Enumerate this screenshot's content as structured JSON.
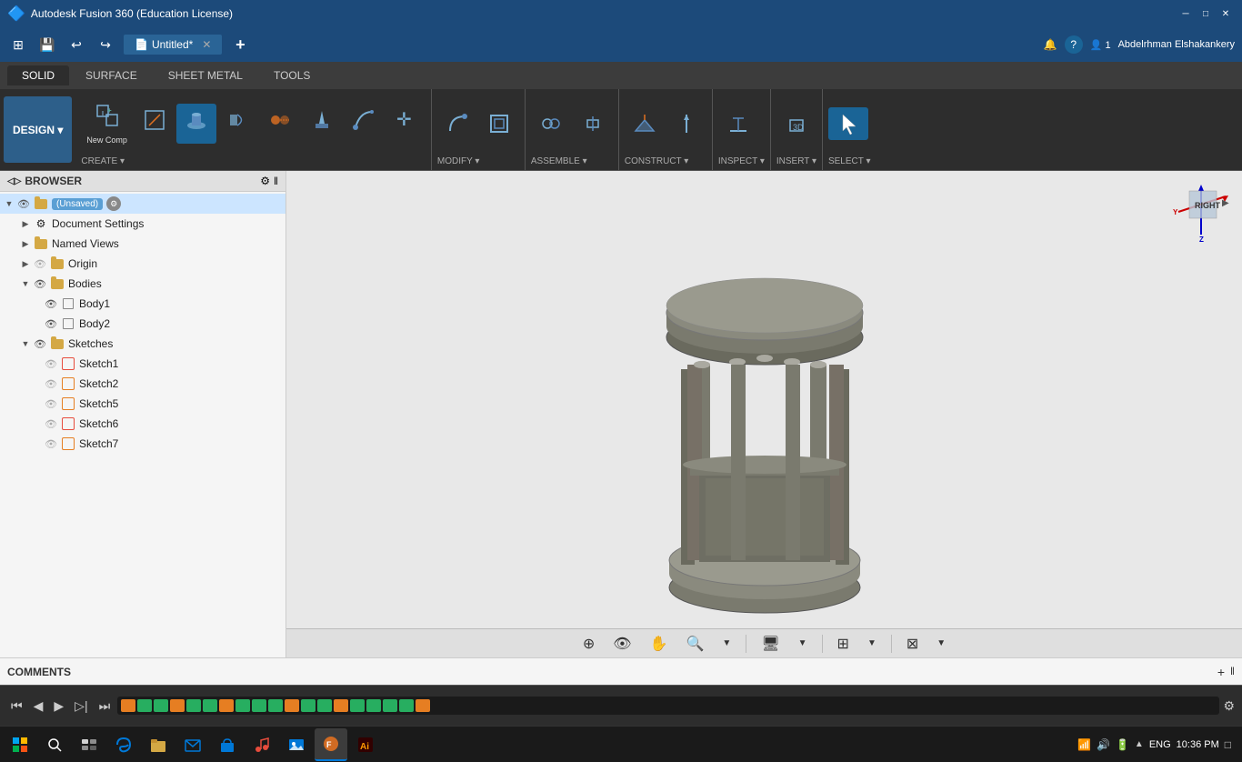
{
  "app": {
    "title": "Autodesk Fusion 360 (Education License)",
    "icon": "🔷"
  },
  "window_controls": {
    "minimize": "─",
    "maximize": "□",
    "close": "✕"
  },
  "header": {
    "file_tab": "Untitled*",
    "file_tab_close": "✕",
    "user": "Abdelrhman Elshakankery",
    "user_icon": "👤",
    "count": "1",
    "help": "?",
    "plus": "+",
    "refresh": "↺"
  },
  "ribbon": {
    "design_label": "DESIGN ▾",
    "tabs": [
      "SOLID",
      "SURFACE",
      "SHEET METAL",
      "TOOLS"
    ],
    "active_tab": "SOLID",
    "sections": {
      "create": {
        "label": "CREATE ▾",
        "buttons": [
          {
            "icon": "⊞",
            "label": "New Comp"
          },
          {
            "icon": "◻",
            "label": ""
          },
          {
            "icon": "◑",
            "label": ""
          },
          {
            "icon": "▣",
            "label": ""
          },
          {
            "icon": "✦",
            "label": ""
          },
          {
            "icon": "◧",
            "label": ""
          },
          {
            "icon": "⬡",
            "label": ""
          },
          {
            "icon": "⬢",
            "label": ""
          },
          {
            "icon": "✛",
            "label": ""
          }
        ]
      },
      "modify": {
        "label": "MODIFY ▾"
      },
      "assemble": {
        "label": "ASSEMBLE ▾"
      },
      "construct": {
        "label": "CONSTRUCT ▾"
      },
      "inspect": {
        "label": "INSPECT ▾"
      },
      "insert": {
        "label": "INSERT ▾"
      },
      "select": {
        "label": "SELECT ▾"
      }
    }
  },
  "browser": {
    "title": "BROWSER",
    "items": [
      {
        "id": "root",
        "label": "(Unsaved)",
        "type": "root",
        "indent": 0,
        "expanded": true,
        "visible": true
      },
      {
        "id": "doc-settings",
        "label": "Document Settings",
        "type": "settings",
        "indent": 1,
        "expanded": false,
        "visible": false
      },
      {
        "id": "named-views",
        "label": "Named Views",
        "type": "folder",
        "indent": 1,
        "expanded": false,
        "visible": false
      },
      {
        "id": "origin",
        "label": "Origin",
        "type": "origin",
        "indent": 1,
        "expanded": false,
        "visible": false
      },
      {
        "id": "bodies",
        "label": "Bodies",
        "type": "folder",
        "indent": 1,
        "expanded": true,
        "visible": true
      },
      {
        "id": "body1",
        "label": "Body1",
        "type": "body",
        "indent": 2,
        "expanded": false,
        "visible": true
      },
      {
        "id": "body2",
        "label": "Body2",
        "type": "body",
        "indent": 2,
        "expanded": false,
        "visible": true
      },
      {
        "id": "sketches",
        "label": "Sketches",
        "type": "folder",
        "indent": 1,
        "expanded": true,
        "visible": true
      },
      {
        "id": "sketch1",
        "label": "Sketch1",
        "type": "sketch-red",
        "indent": 2,
        "expanded": false,
        "visible": false
      },
      {
        "id": "sketch2",
        "label": "Sketch2",
        "type": "sketch",
        "indent": 2,
        "expanded": false,
        "visible": false
      },
      {
        "id": "sketch5",
        "label": "Sketch5",
        "type": "sketch",
        "indent": 2,
        "expanded": false,
        "visible": false
      },
      {
        "id": "sketch6",
        "label": "Sketch6",
        "type": "sketch-red",
        "indent": 2,
        "expanded": false,
        "visible": false
      },
      {
        "id": "sketch7",
        "label": "Sketch7",
        "type": "sketch",
        "indent": 2,
        "expanded": false,
        "visible": false
      }
    ]
  },
  "viewport": {
    "nav_cube": {
      "right_label": "RIGHT",
      "arrow": "▶"
    }
  },
  "viewport_toolbar": {
    "buttons": [
      "⊕",
      "📷",
      "✋",
      "🔍",
      "🖥",
      "⊞",
      "⊠"
    ]
  },
  "comments": {
    "label": "COMMENTS",
    "add_icon": "+",
    "collapse_icon": "‖"
  },
  "timeline": {
    "play_prev": "⏮",
    "play_back": "◀",
    "play": "▶",
    "play_next_step": "▷▌",
    "play_end": "⏭",
    "items": [
      "sketch",
      "sketch",
      "feature",
      "feature",
      "sketch",
      "sketch",
      "feature",
      "feature",
      "feature",
      "feature",
      "sketch",
      "feature",
      "feature",
      "sketch",
      "feature",
      "feature",
      "feature",
      "feature",
      "sketch"
    ],
    "settings": "⚙"
  },
  "taskbar": {
    "start_icon": "⊞",
    "buttons": [
      "🔍",
      "🗂",
      "🌐",
      "📁",
      "📧",
      "📁",
      "🎵",
      "📺",
      "🔷",
      "Ai"
    ],
    "systray": {
      "network": "📶",
      "volume": "🔊",
      "battery": "🔋",
      "lang": "ENG",
      "time": "10:36 PM",
      "notification": "□"
    }
  }
}
